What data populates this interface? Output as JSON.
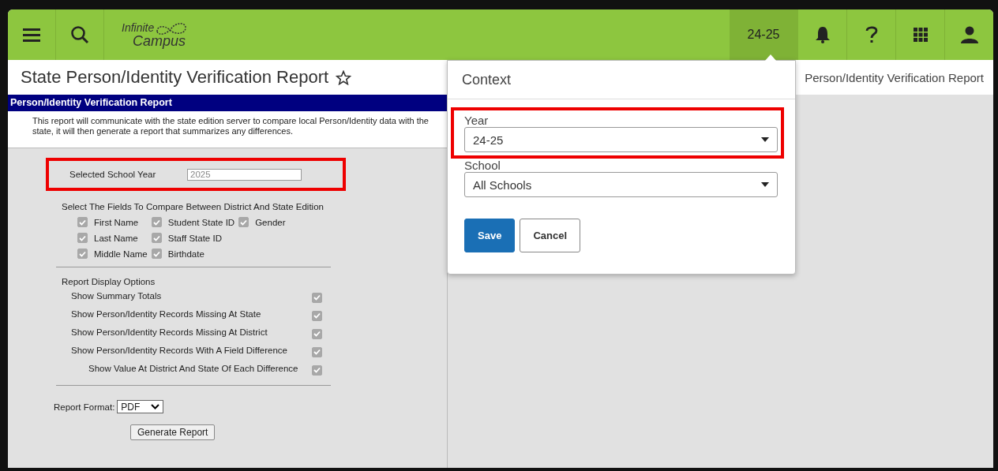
{
  "header": {
    "logo": {
      "line_1": "Infinite",
      "line_2": "Campus"
    },
    "context_button": {
      "label": "24-25",
      "active": true
    }
  },
  "page_title": "State Person/Identity Verification Report",
  "breadcrumb": "Person/Identity Verification Report",
  "report": {
    "heading": "Person/Identity Verification Report",
    "description": "This report will communicate with the state edition server to compare local Person/Identity data with the state, it will then generate a report that summarizes any differences.",
    "school_year": {
      "label": "Selected School Year",
      "value": "2025",
      "disabled": true,
      "highlighted": true
    },
    "fields_heading": "Select The Fields To Compare Between District And State Edition",
    "field_rows": [
      {
        "items": [
          {
            "label": "First Name",
            "checked": true
          },
          {
            "label": "Student State ID",
            "checked": true
          },
          {
            "label": "Gender",
            "checked": true
          }
        ]
      },
      {
        "items": [
          {
            "label": "Last Name",
            "checked": true
          },
          {
            "label": "Staff State ID",
            "checked": true
          }
        ]
      },
      {
        "items": [
          {
            "label": "Middle Name",
            "checked": true
          },
          {
            "label": "Birthdate",
            "checked": true
          }
        ]
      }
    ],
    "display_heading": "Report Display Options",
    "display_options": [
      {
        "label": "Show Summary Totals",
        "checked": true,
        "indented": false
      },
      {
        "label": "Show Person/Identity Records Missing At State",
        "checked": true,
        "indented": false
      },
      {
        "label": "Show Person/Identity Records Missing At District",
        "checked": true,
        "indented": false
      },
      {
        "label": "Show Person/Identity Records With A Field Difference",
        "checked": true,
        "indented": false
      },
      {
        "label": "Show Value At District And State Of Each Difference",
        "checked": true,
        "indented": true
      }
    ],
    "format": {
      "label": "Report Format:",
      "value": "PDF"
    },
    "generate_button": "Generate Report"
  },
  "context_popup": {
    "title": "Context",
    "year": {
      "label": "Year",
      "value": "24-25",
      "highlighted": true
    },
    "school": {
      "label": "School",
      "value": "All Schools",
      "highlighted": false
    },
    "buttons": [
      {
        "label": "Save",
        "kind": "primary"
      },
      {
        "label": "Cancel",
        "kind": "secondary"
      }
    ]
  }
}
